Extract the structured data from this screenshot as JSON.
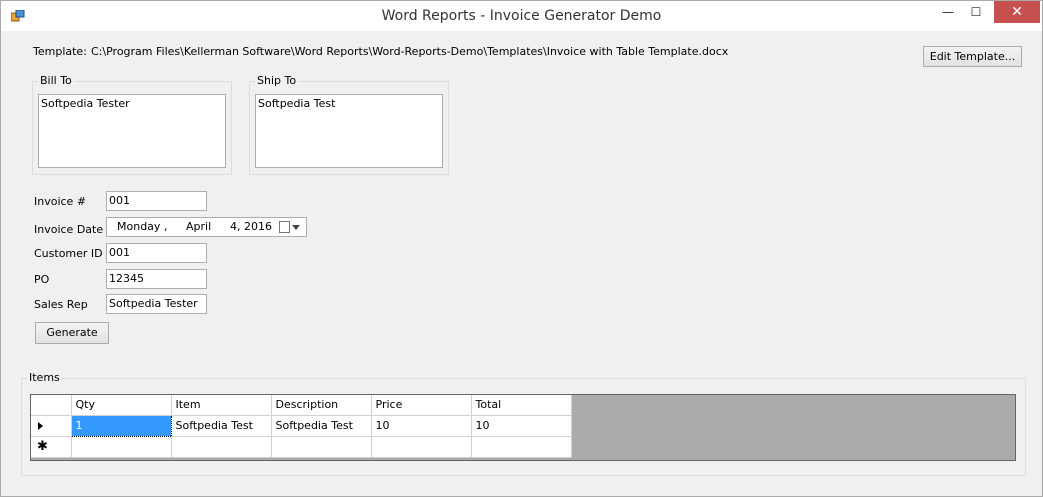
{
  "window": {
    "title": "Word Reports - Invoice Generator Demo",
    "minimize_glyph": "—",
    "maximize_glyph": "☐",
    "close_glyph": "✕"
  },
  "template": {
    "label": "Template:",
    "path": "C:\\Program Files\\Kellerman Software\\Word Reports\\Word-Reports-Demo\\Templates\\Invoice with Table Template.docx",
    "edit_button": "Edit Template..."
  },
  "bill_to": {
    "title": "Bill To",
    "value": "Softpedia Tester"
  },
  "ship_to": {
    "title": "Ship To",
    "value": "Softpedia Test"
  },
  "fields": {
    "invoice_label": "Invoice #",
    "invoice_value": "001",
    "date_label": "Invoice Date",
    "date_day": "Monday",
    "date_sep": ",",
    "date_month": "April",
    "date_dom": "4,",
    "date_year": "2016",
    "customer_label": "Customer ID",
    "customer_value": "001",
    "po_label": "PO",
    "po_value": "12345",
    "salesrep_label": "Sales Rep",
    "salesrep_value": "Softpedia Tester"
  },
  "generate_button": "Generate",
  "items": {
    "title": "Items",
    "columns": [
      "Qty",
      "Item",
      "Description",
      "Price",
      "Total"
    ],
    "rows": [
      [
        "1",
        "Softpedia Test",
        "Softpedia Test",
        "10",
        "10"
      ]
    ],
    "new_row_glyph": "✱"
  }
}
